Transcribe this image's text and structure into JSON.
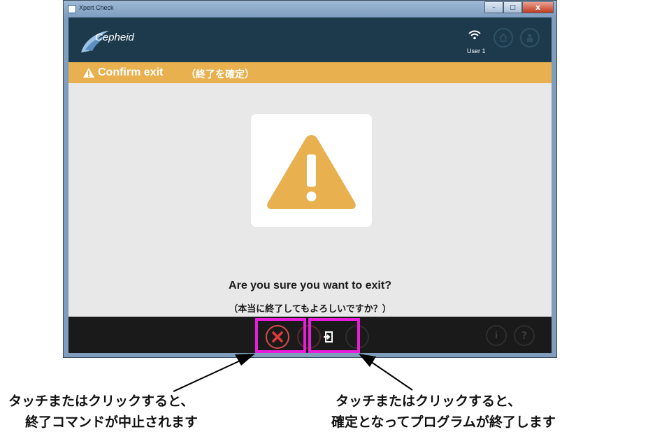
{
  "window": {
    "title": "Xpert Check",
    "minimize": "–",
    "maximize": "□",
    "close": "x"
  },
  "header": {
    "brand": "Cepheid",
    "user": "User 1",
    "home_icon": "home-icon",
    "person_icon": "person-icon"
  },
  "banner": {
    "title": "Confirm exit",
    "subtitle": "（終了を確定）"
  },
  "dialog": {
    "question": "Are you sure you want to exit?",
    "question_jp": "（本当に終了してもよろしいですか？）"
  },
  "footer": {
    "info_glyph": "i",
    "help_glyph": "?"
  },
  "annotations": {
    "left_caption_line1": "タッチまたはクリックすると、",
    "left_caption_line2": "終了コマンドが中止されます",
    "right_caption_line1": "タッチまたはクリックすると、",
    "right_caption_line2": "確定となってプログラムが終了します"
  },
  "colors": {
    "header": "#1d3a4d",
    "banner": "#e8b04e",
    "warning": "#e8b04e",
    "footer": "#1a1a1a",
    "highlight": "#e81ed8",
    "cancel": "#d64b4b"
  }
}
